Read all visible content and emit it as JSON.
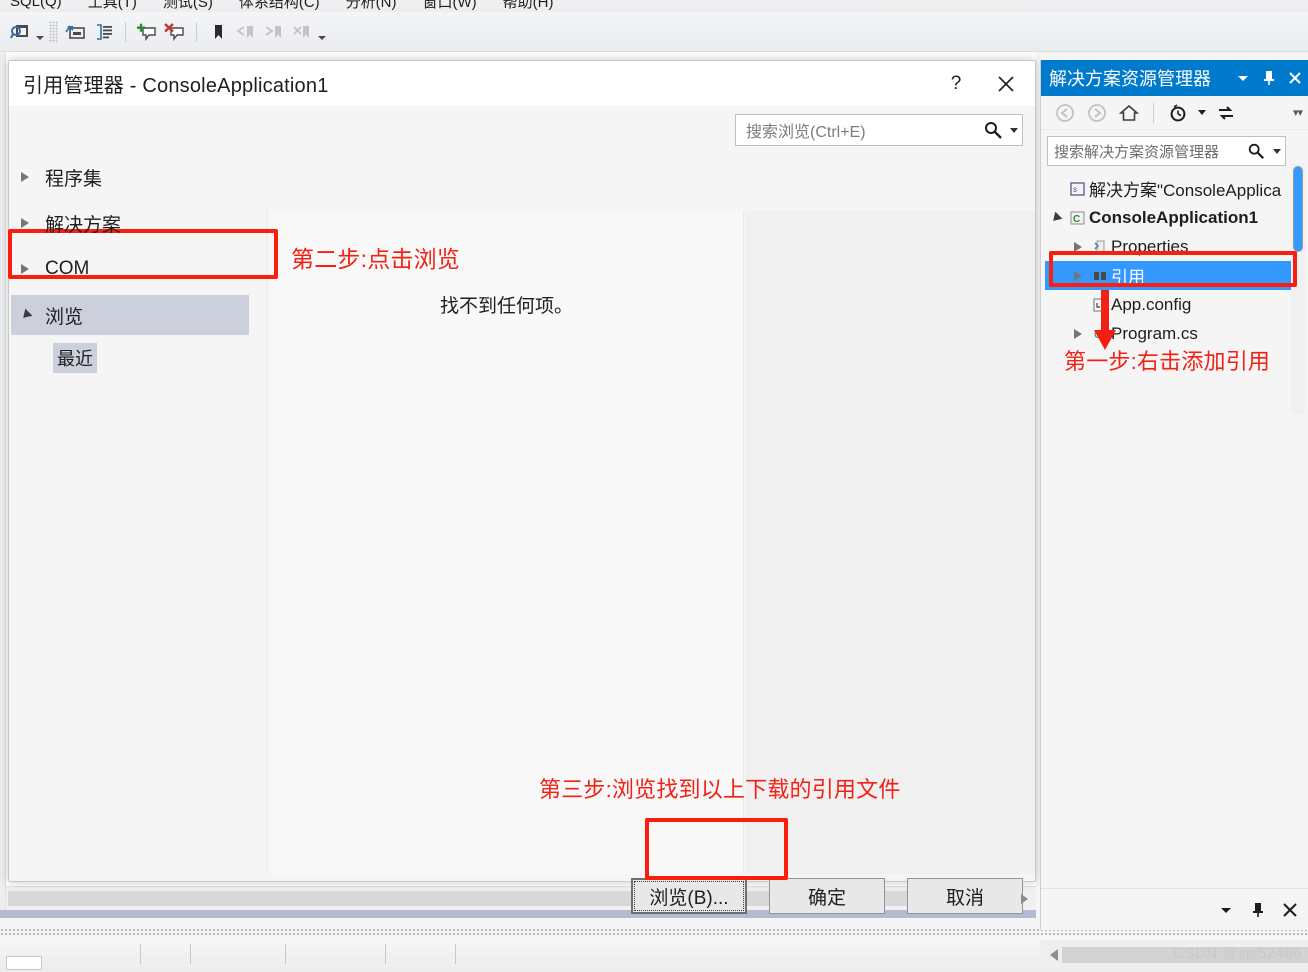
{
  "ide": {
    "menu_items": [
      "SQL(Q)",
      "工具(T)",
      "测试(S)",
      "体系结构(C)",
      "分析(N)",
      "窗口(W)",
      "帮助(H)"
    ],
    "toolbar_icons": [
      "find-in-files-icon",
      "toolbar-gripper",
      "navigate-to-icon",
      "comment-selection-icon",
      "add-comment-icon",
      "remove-comment-icon",
      "bookmark-icon",
      "previous-bookmark-icon",
      "next-bookmark-icon",
      "clear-bookmarks-icon"
    ]
  },
  "dialog": {
    "title": "引用管理器 - ConsoleApplication1",
    "help_label": "?",
    "close_label": "✕",
    "search": {
      "placeholder": "搜索浏览(Ctrl+E)",
      "icon": "search-icon"
    },
    "categories": [
      {
        "label": "程序集",
        "expanded": false,
        "selected": false
      },
      {
        "label": "解决方案",
        "expanded": false,
        "selected": false
      },
      {
        "label": "COM",
        "expanded": false,
        "selected": false
      },
      {
        "label": "浏览",
        "expanded": true,
        "selected": true
      }
    ],
    "sub_item": "最近",
    "empty_message": "找不到任何项。",
    "buttons": {
      "browse": "浏览(B)...",
      "ok": "确定",
      "cancel": "取消"
    }
  },
  "annotations": {
    "step1": "第一步:右击添加引用",
    "step2": "第二步:点击浏览",
    "step3": "第三步:浏览找到以上下载的引用文件",
    "color": "#f32013"
  },
  "solution_explorer": {
    "title": "解决方案资源管理器",
    "header_buttons": [
      "chevron-down-icon",
      "pin-icon",
      "close-icon"
    ],
    "toolbar_icons": [
      "back-arrow-icon",
      "forward-arrow-icon",
      "home-icon",
      "pending-changes-icon",
      "refresh-icon"
    ],
    "search": {
      "placeholder": "搜索解决方案资源管理器",
      "icon": "search-icon"
    },
    "tree": [
      {
        "label": "解决方案\"ConsoleApplica",
        "icon": "solution-icon",
        "indent": 0,
        "expander": "none",
        "bold": false,
        "selected": false
      },
      {
        "label": "ConsoleApplication1",
        "icon": "csharp-project-icon",
        "indent": 0,
        "expander": "open",
        "bold": true,
        "selected": false
      },
      {
        "label": "Properties",
        "icon": "properties-icon",
        "indent": 1,
        "expander": "closed",
        "bold": false,
        "selected": false
      },
      {
        "label": "引用",
        "icon": "references-icon",
        "indent": 1,
        "expander": "closed",
        "bold": false,
        "selected": true
      },
      {
        "label": "App.config",
        "icon": "config-file-icon",
        "indent": 1,
        "expander": "none",
        "bold": false,
        "selected": false
      },
      {
        "label": "Program.cs",
        "icon": "csharp-file-icon",
        "indent": 1,
        "expander": "closed",
        "bold": false,
        "selected": false
      }
    ],
    "footer_buttons": [
      "chevron-down-icon",
      "pin-icon",
      "close-icon"
    ]
  },
  "watermark": "CSDN @sjs52406"
}
